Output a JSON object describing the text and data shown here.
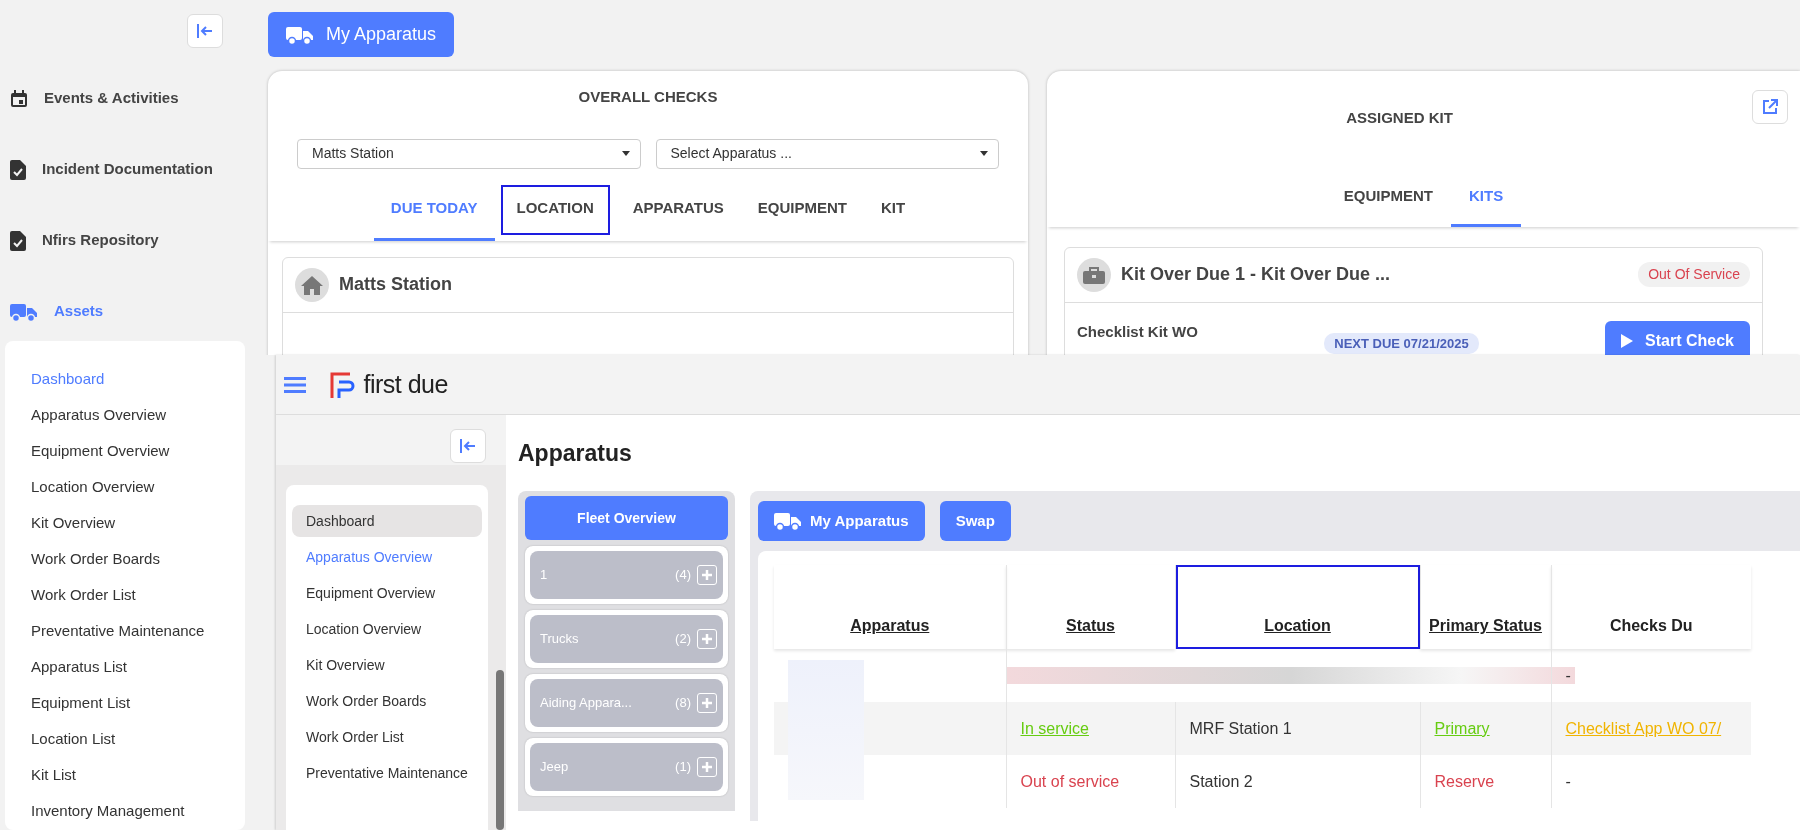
{
  "sidebar": {
    "items": [
      {
        "label": "Events & Activities",
        "selected": false
      },
      {
        "label": "Incident Documentation",
        "selected": false
      },
      {
        "label": "Nfirs Repository",
        "selected": false
      },
      {
        "label": "Assets",
        "selected": true
      }
    ],
    "submenu": [
      {
        "label": "Dashboard",
        "selected": true
      },
      {
        "label": "Apparatus Overview",
        "selected": false
      },
      {
        "label": "Equipment Overview",
        "selected": false
      },
      {
        "label": "Location Overview",
        "selected": false
      },
      {
        "label": "Kit Overview",
        "selected": false
      },
      {
        "label": "Work Order Boards",
        "selected": false
      },
      {
        "label": "Work Order List",
        "selected": false
      },
      {
        "label": "Preventative Maintenance",
        "selected": false
      },
      {
        "label": "Apparatus List",
        "selected": false
      },
      {
        "label": "Equipment List",
        "selected": false
      },
      {
        "label": "Location List",
        "selected": false
      },
      {
        "label": "Kit List",
        "selected": false
      },
      {
        "label": "Inventory Management",
        "selected": false
      }
    ]
  },
  "my_apparatus_button": "My Apparatus",
  "overall_checks": {
    "title": "OVERALL CHECKS",
    "location_select": "Matts Station",
    "apparatus_select": {
      "placeholder": "Select Apparatus ..."
    },
    "tabs": [
      {
        "label": "DUE TODAY",
        "selected": true,
        "highlighted": false
      },
      {
        "label": "LOCATION",
        "selected": false,
        "highlighted": true
      },
      {
        "label": "APPARATUS",
        "selected": false,
        "highlighted": false
      },
      {
        "label": "EQUIPMENT",
        "selected": false,
        "highlighted": false
      },
      {
        "label": "KIT",
        "selected": false,
        "highlighted": false
      }
    ],
    "location_card": {
      "title": "Matts Station"
    }
  },
  "assigned_kit": {
    "title": "ASSIGNED KIT",
    "tabs": [
      {
        "label": "EQUIPMENT",
        "selected": false
      },
      {
        "label": "KITS",
        "selected": true
      }
    ],
    "kit": {
      "title": "Kit Over Due 1 - Kit Over Due ...",
      "status": "Out Of Service",
      "checklist": "Checklist Kit WO",
      "next_due": "NEXT DUE 07/21/2025",
      "button": "Start Check"
    }
  },
  "overlay": {
    "brand": "first due",
    "sidebar_items": [
      {
        "label": "Dashboard",
        "selected": false,
        "hovered": true
      },
      {
        "label": "Apparatus Overview",
        "selected": true,
        "hovered": false
      },
      {
        "label": "Equipment Overview",
        "selected": false,
        "hovered": false
      },
      {
        "label": "Location Overview",
        "selected": false,
        "hovered": false
      },
      {
        "label": "Kit Overview",
        "selected": false,
        "hovered": false
      },
      {
        "label": "Work Order Boards",
        "selected": false,
        "hovered": false
      },
      {
        "label": "Work Order List",
        "selected": false,
        "hovered": false
      },
      {
        "label": "Preventative Maintenance",
        "selected": false,
        "hovered": false
      }
    ],
    "heading": "Apparatus",
    "fleet": {
      "button": "Fleet Overview",
      "groups": [
        {
          "name": "1",
          "count": "(4)"
        },
        {
          "name": "Trucks",
          "count": "(2)"
        },
        {
          "name": "Aiding Appara...",
          "count": "(8)"
        },
        {
          "name": "Jeep",
          "count": "(1)"
        }
      ]
    },
    "buttons": [
      "My Apparatus",
      "Swap"
    ],
    "table": {
      "columns": [
        {
          "label": "Apparatus",
          "highlighted": false
        },
        {
          "label": "Status",
          "highlighted": false
        },
        {
          "label": "Location",
          "highlighted": true
        },
        {
          "label": "Primary Status",
          "highlighted": false
        },
        {
          "label": "Checks Du",
          "highlighted": false
        }
      ],
      "rows": [
        {
          "kind": "loading",
          "checks": {
            "text": "-",
            "link": false,
            "color": "#333333"
          }
        },
        {
          "kind": "data",
          "status": {
            "text": "In service",
            "link": true,
            "color": "#66cc11"
          },
          "location": "MRF Station 1",
          "primary": {
            "text": "Primary",
            "link": true,
            "color": "#66cc11"
          },
          "checks": {
            "text": "Checklist App WO 07/",
            "link": true,
            "color": "#f0b400"
          }
        },
        {
          "kind": "data",
          "status": {
            "text": "Out of service",
            "link": false,
            "color": "#d9434f"
          },
          "location": "Station 2",
          "primary": {
            "text": "Reserve",
            "link": false,
            "color": "#d9434f"
          },
          "checks": {
            "text": "-",
            "link": false,
            "color": "#333333"
          }
        }
      ]
    }
  }
}
